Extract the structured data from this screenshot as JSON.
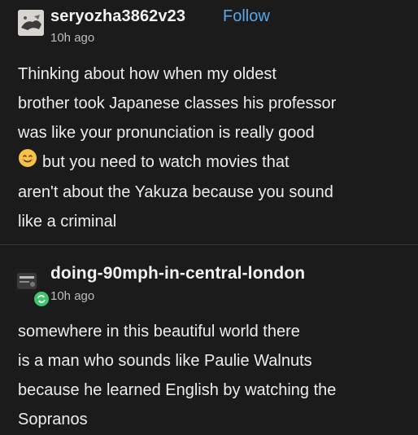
{
  "posts": [
    {
      "username": "seryozha3862v23",
      "follow_label": "Follow",
      "time": "10h ago",
      "lines": [
        "Thinking about how when my oldest",
        "brother took Japanese classes his professor",
        "was like your pronunciation is really good",
        "but you need to watch movies that",
        "aren't about the Yakuza because you sound",
        "like a criminal"
      ],
      "emoji": "smiling-face-emoji"
    },
    {
      "username": "doing-90mph-in-central-london",
      "time": "10h ago",
      "lines": [
        "somewhere in this beautiful world there",
        "is a man who sounds like Paulie Walnuts",
        "because he learned English by watching the",
        "Sopranos"
      ]
    }
  ],
  "colors": {
    "background": "#1b1b1b",
    "follow": "#58a8e8",
    "reblog_badge": "#3ec46d"
  }
}
